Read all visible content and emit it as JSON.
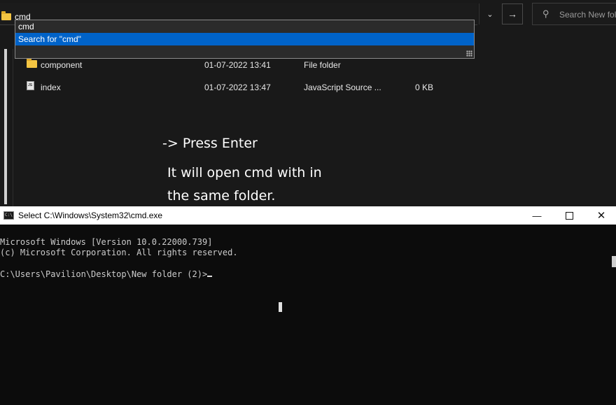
{
  "explorer": {
    "address_text": "cmd",
    "search_placeholder": "Search New fol",
    "suggestions": [
      "cmd",
      "Search for \"cmd\""
    ],
    "files": [
      {
        "name": "component",
        "date": "01-07-2022 13:41",
        "type": "File folder",
        "size": "",
        "icon": "folder-icon"
      },
      {
        "name": "index",
        "date": "01-07-2022 13:47",
        "type": "JavaScript Source ...",
        "size": "0 KB",
        "icon": "js-file-icon"
      }
    ]
  },
  "annotation": {
    "step": "-> Press Enter",
    "note_line1": "It will open cmd with in",
    "note_line2": "the same folder."
  },
  "cmd": {
    "title": "Select C:\\Windows\\System32\\cmd.exe",
    "icon_text": "C:\\",
    "lines": [
      "Microsoft Windows [Version 10.0.22000.739]",
      "(c) Microsoft Corporation. All rights reserved.",
      "",
      "C:\\Users\\Pavilion\\Desktop\\New folder (2)>"
    ],
    "controls": {
      "minimize": "—",
      "maximize": "",
      "close": "✕"
    }
  },
  "colors": {
    "selection": "#0063c9",
    "folder": "#f4c542",
    "console_text": "#cccccc"
  }
}
